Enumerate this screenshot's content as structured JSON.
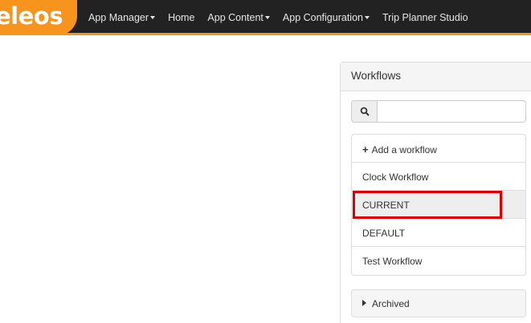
{
  "brand": {
    "logo_text": "eleos",
    "accent_color": "#f7941d"
  },
  "nav": {
    "items": [
      {
        "label": "App Manager",
        "dropdown": true
      },
      {
        "label": "Home",
        "dropdown": false
      },
      {
        "label": "App Content",
        "dropdown": true
      },
      {
        "label": "App Configuration",
        "dropdown": true
      },
      {
        "label": "Trip Planner Studio",
        "dropdown": false
      }
    ]
  },
  "workflows_panel": {
    "title": "Workflows",
    "search": {
      "value": "",
      "placeholder": ""
    },
    "add_label": "Add a workflow",
    "items": [
      {
        "label": "Clock Workflow"
      },
      {
        "label": "CURRENT"
      },
      {
        "label": "DEFAULT"
      },
      {
        "label": "Test Workflow"
      }
    ],
    "archived_label": "Archived",
    "highlight_color": "#e00000"
  }
}
